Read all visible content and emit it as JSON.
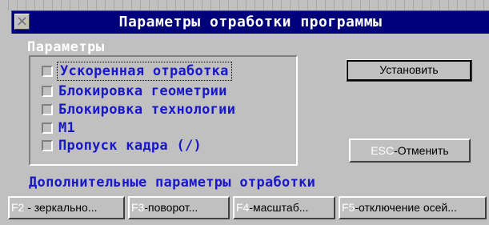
{
  "window": {
    "title": "Параметры отработки программы",
    "close_glyph": "×"
  },
  "params_group": {
    "label": "Параметры",
    "items": [
      {
        "label": "Ускоренная отработка",
        "checked": false
      },
      {
        "label": "Блокировка геометрии",
        "checked": false
      },
      {
        "label": "Блокировка технологии",
        "checked": false
      },
      {
        "label": "M1",
        "checked": false
      },
      {
        "label": "Пропуск кадра (/)",
        "checked": false
      }
    ]
  },
  "buttons": {
    "set_label": "Установить",
    "cancel_key": "ESC",
    "cancel_label": "-Отменить"
  },
  "extra": {
    "label": "Дополнительные параметры отработки"
  },
  "function_keys": [
    {
      "key": "F2",
      "label": " - зеркально..."
    },
    {
      "key": "F3",
      "label": "-поворот..."
    },
    {
      "key": "F4",
      "label": "-масштаб..."
    },
    {
      "key": "F5",
      "label": "-отключение осей..."
    }
  ]
}
